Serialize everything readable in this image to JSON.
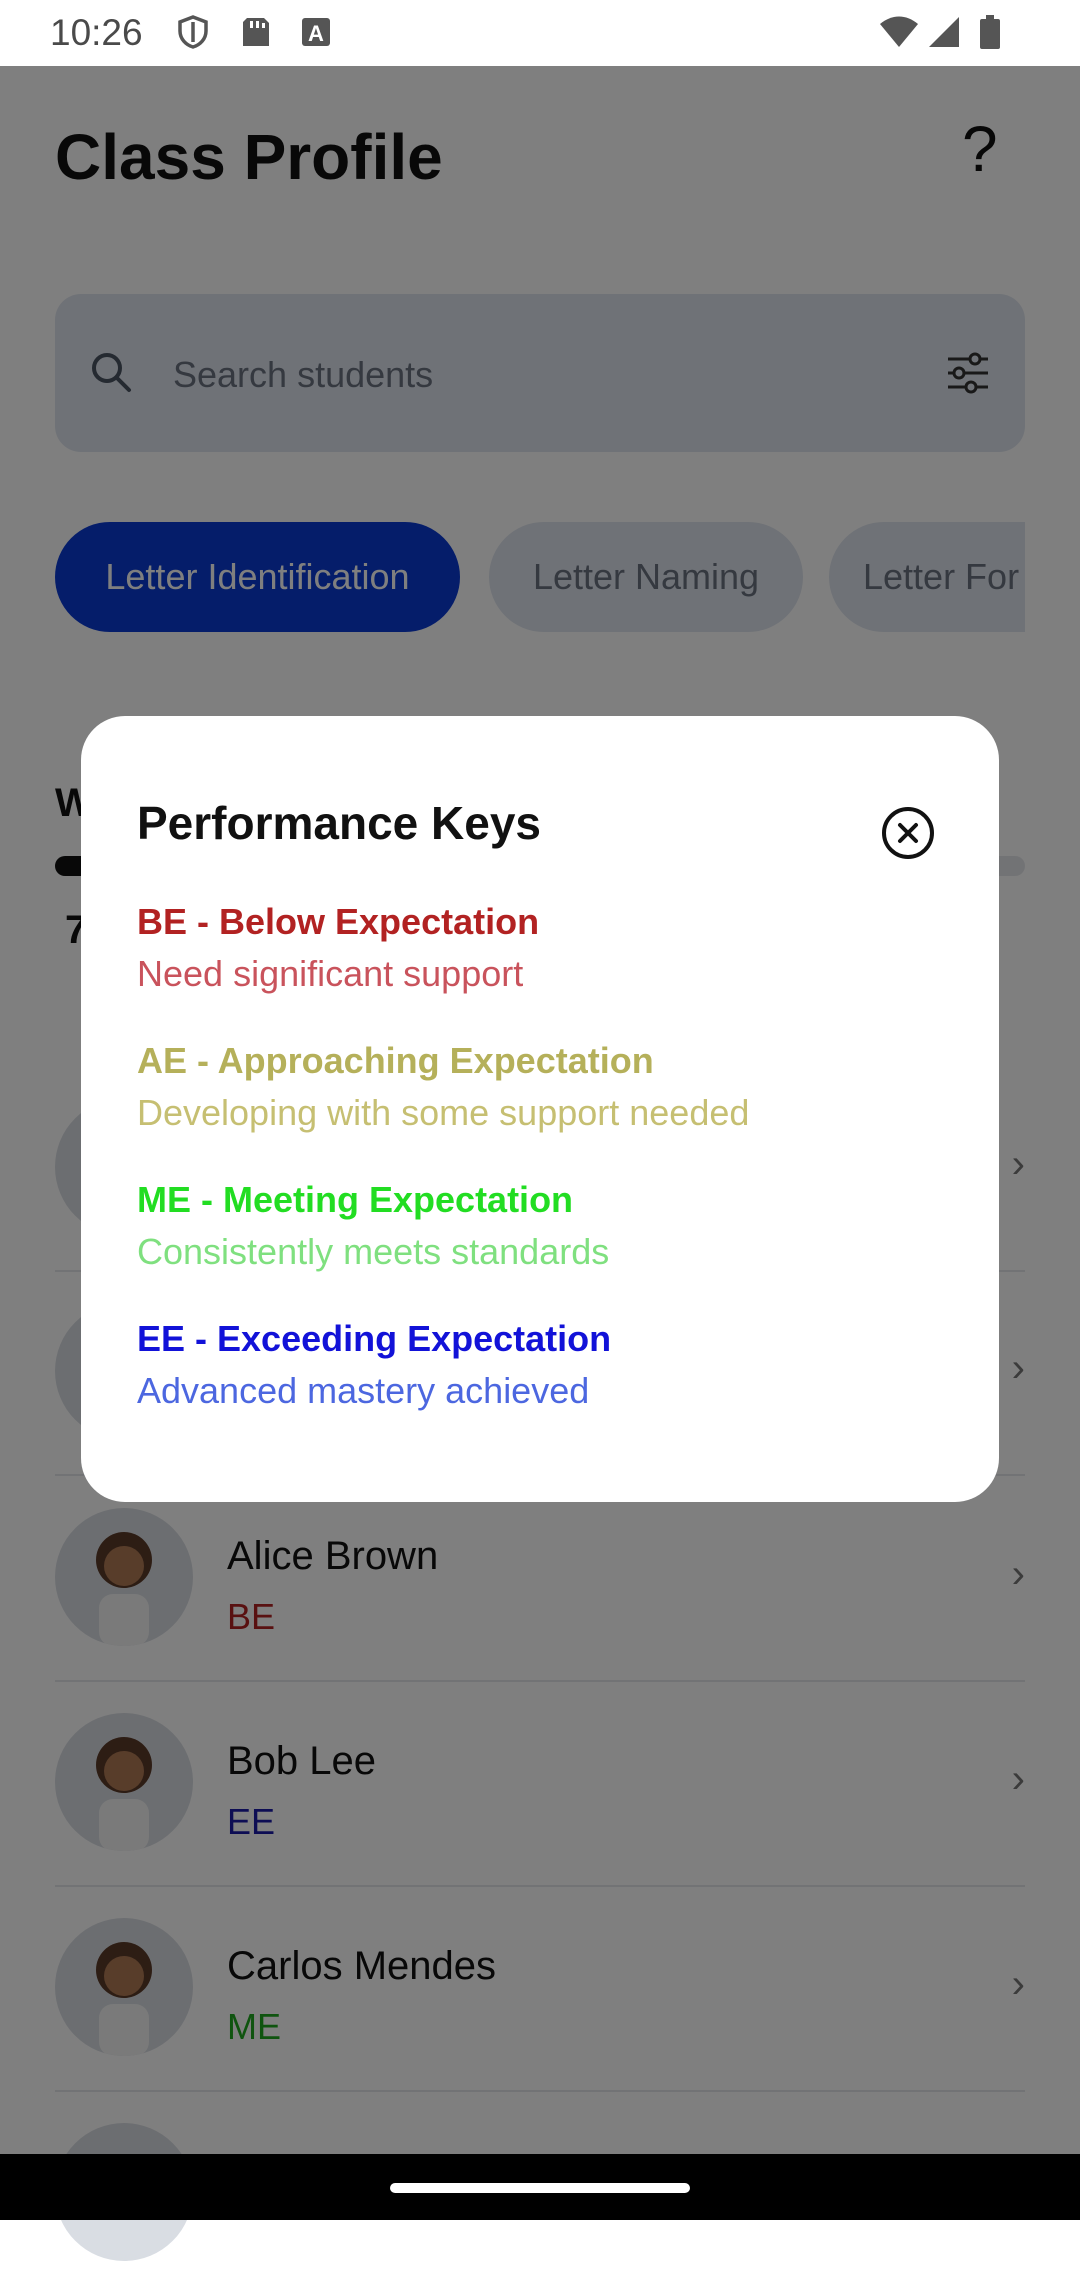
{
  "status_bar": {
    "time": "10:26",
    "left_icons": [
      "shield-icon",
      "sd-card-icon",
      "text-a-icon"
    ],
    "right_icons": [
      "wifi-icon",
      "signal-icon",
      "battery-icon"
    ]
  },
  "header": {
    "title": "Class Profile",
    "help_label": "?"
  },
  "search": {
    "placeholder": "Search students"
  },
  "tabs": [
    {
      "label": "Letter Identification",
      "active": true
    },
    {
      "label": "Letter Naming",
      "active": false
    },
    {
      "label": "Letter For",
      "active": false
    }
  ],
  "behind_modal": {
    "heading_peek": "W",
    "count_peek": "7",
    "progress_fraction": 0.06
  },
  "students": [
    {
      "name": "Alice Brown",
      "level": "BE",
      "level_color": "#b22222"
    },
    {
      "name": "Bob Lee",
      "level": "EE",
      "level_color": "#1a1aa8"
    },
    {
      "name": "Carlos Mendes",
      "level": "ME",
      "level_color": "#1ea81e"
    }
  ],
  "modal": {
    "title": "Performance Keys",
    "keys": [
      {
        "title": "BE - Below Expectation",
        "desc": "Need significant support",
        "title_color": "#b22222",
        "desc_color": "#c9535c"
      },
      {
        "title": "AE - Approaching Expectation",
        "desc": "Developing with some support needed",
        "title_color": "#b5b05a",
        "desc_color": "#c6bf72"
      },
      {
        "title": "ME - Meeting Expectation",
        "desc": "Consistently meets standards",
        "title_color": "#22dd22",
        "desc_color": "#7fe07f"
      },
      {
        "title": "EE - Exceeding Expectation",
        "desc": "Advanced mastery achieved",
        "title_color": "#1212d8",
        "desc_color": "#4c67e0"
      }
    ]
  }
}
